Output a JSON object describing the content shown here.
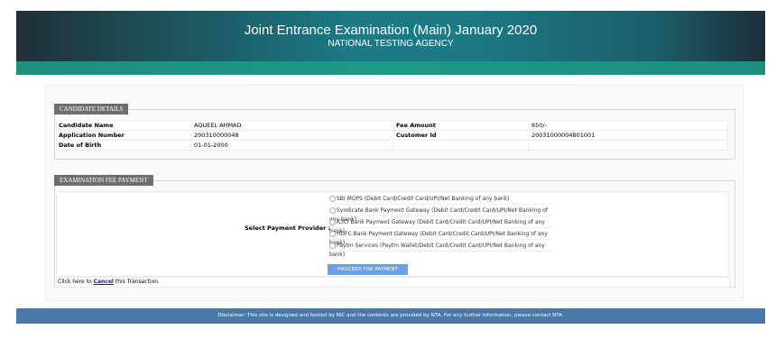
{
  "header": {
    "title": "Joint Entrance Examination (Main) January 2020",
    "subtitle": "NATIONAL TESTING AGENCY"
  },
  "candidate": {
    "legend": "CANDIDATE DETAILS",
    "rows": [
      {
        "l1": "Candidate Name",
        "v1": "AQUEEL AHMAD",
        "l2": "Fee Amount",
        "v2": "650/-"
      },
      {
        "l1": "Application Number",
        "v1": "200310000048",
        "l2": "Customer Id",
        "v2": "20031000004801001"
      },
      {
        "l1": "Date of Birth",
        "v1": "01-01-2000",
        "l2": "",
        "v2": ""
      }
    ]
  },
  "payment": {
    "legend": "EXAMINATION FEE PAYMENT",
    "label": "Select Payment Provider :",
    "options": [
      "SBI MOPS (Debit Card/Credit Card/UPI/Net Banking of any bank)",
      "Syndicate Bank Payment Gateway (Debit Card/Credit Card/UPI/Net Banking of any bank)",
      "ICICI Bank Payment Gateway (Debit Card/Credit Card/UPI/Net Banking of any bank)",
      "HDFC Bank Payment Gateway (Debit Card/Credit Card/UPI/Net Banking of any bank)",
      "Paytm Services (Paytm Wallet/Debit Card/Credit Card/UPI/Net Banking of any bank)"
    ],
    "proceed_label": "PROCEED FOR PAYMENT",
    "cancel_prefix": "Click here to ",
    "cancel_link": "Cancel",
    "cancel_suffix": " this Transaction."
  },
  "footer": {
    "disclaimer": "Disclaimer: This site is designed and hosted by NIC and the contents are provided by NTA. For any further information, please contact NTA."
  },
  "colors": {
    "header": "#1b7a86",
    "strip": "#1a9b88",
    "footer": "#4a78a8",
    "button": "#6aa0e6"
  }
}
